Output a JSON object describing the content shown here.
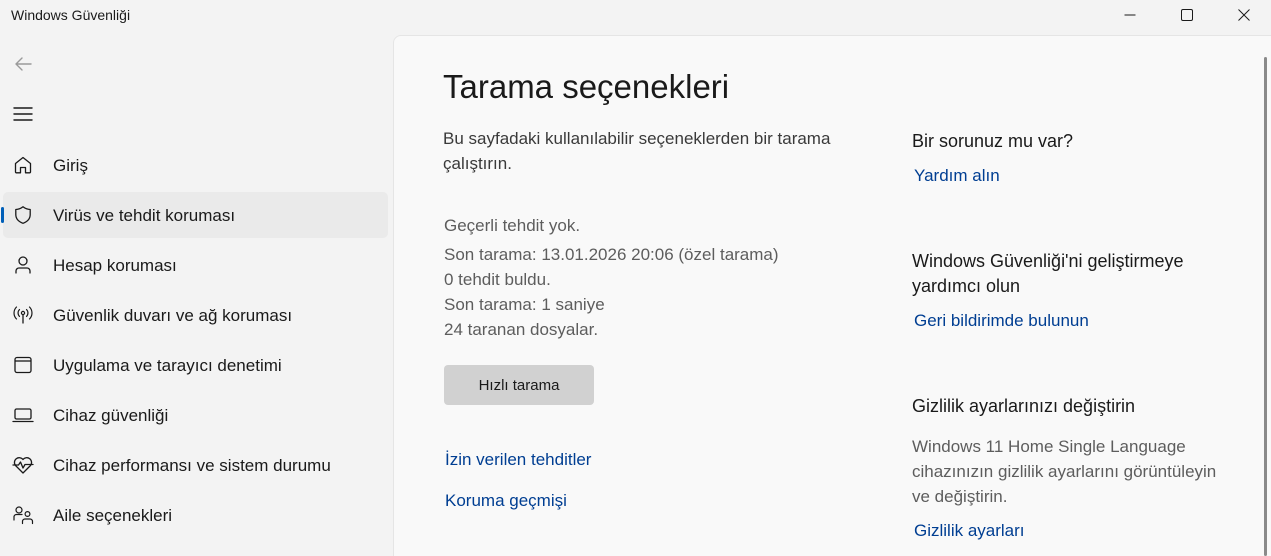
{
  "window": {
    "title": "Windows Güvenliği",
    "minimize_icon": "minimize-icon",
    "maximize_icon": "maximize-icon",
    "close_icon": "close-icon"
  },
  "sidebar": {
    "back_icon": "back-arrow-icon",
    "menu_icon": "hamburger-menu-icon",
    "active_index": 1,
    "accent_color": "#005fb8",
    "items": [
      {
        "label": "Giriş",
        "icon": "home-icon"
      },
      {
        "label": "Virüs ve tehdit koruması",
        "icon": "shield-icon"
      },
      {
        "label": "Hesap koruması",
        "icon": "person-icon"
      },
      {
        "label": "Güvenlik duvarı ve ağ koruması",
        "icon": "wireless-icon"
      },
      {
        "label": "Uygulama ve tarayıcı denetimi",
        "icon": "app-window-icon"
      },
      {
        "label": "Cihaz güvenliği",
        "icon": "laptop-icon"
      },
      {
        "label": "Cihaz performansı ve sistem durumu",
        "icon": "heart-pulse-icon"
      },
      {
        "label": "Aile seçenekleri",
        "icon": "family-icon"
      }
    ]
  },
  "main": {
    "title": "Tarama seçenekleri",
    "description": "Bu sayfadaki kullanılabilir seçeneklerden bir tarama çalıştırın.",
    "status": {
      "threats": "Geçerli tehdit yok.",
      "last_scan": "Son tarama: 13.01.2026 20:06 (özel tarama)",
      "found": "0 tehdit buldu.",
      "duration": "Son tarama: 1 saniye",
      "files": "24 taranan dosyalar."
    },
    "scan_button": "Hızlı tarama",
    "allowed_threats_link": "İzin verilen tehditler",
    "protection_history_link": "Koruma geçmişi",
    "link_color": "#003e92"
  },
  "side": {
    "question_heading": "Bir sorunuz mu var?",
    "help_link": "Yardım alın",
    "improve_heading": "Windows Güvenliği'ni geliştirmeye yardımcı olun",
    "feedback_link": "Geri bildirimde bulunun",
    "privacy_heading": "Gizlilik ayarlarınızı değiştirin",
    "privacy_text": "Windows 11 Home Single Language cihazınızın gizlilik ayarlarını görüntüleyin ve değiştirin.",
    "privacy_link": "Gizlilik ayarları"
  }
}
